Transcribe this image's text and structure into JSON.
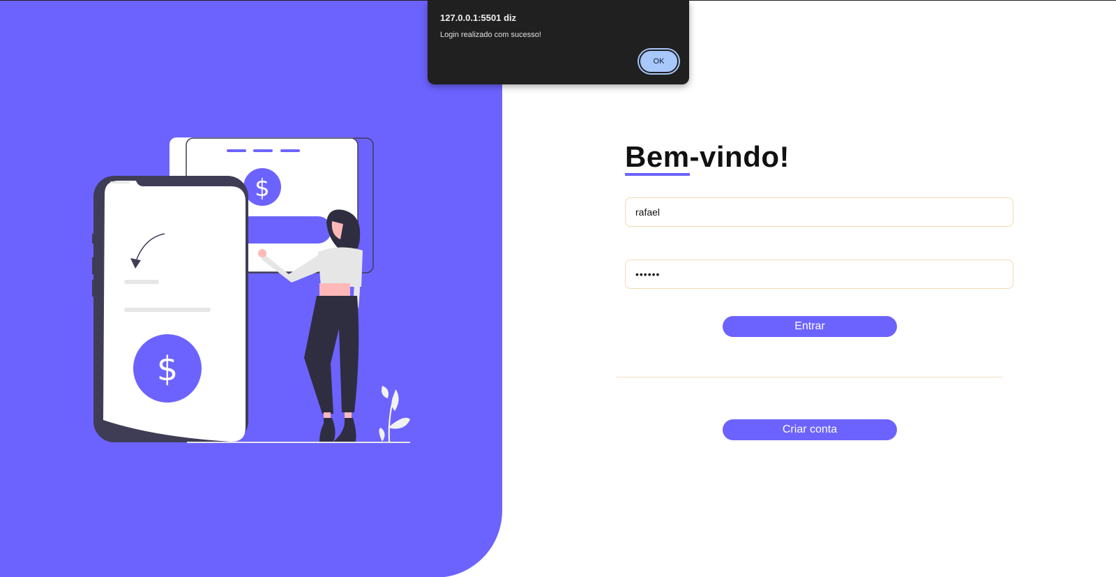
{
  "colors": {
    "accent": "#6c63ff",
    "phone_dark": "#3f3d56",
    "input_border": "#f3d9b3",
    "dialog_bg": "#202020",
    "dialog_button": "#a8c7fa"
  },
  "alert": {
    "origin": "127.0.0.1:5501 diz",
    "message": "Login realizado com sucesso!",
    "ok_label": "OK"
  },
  "illustration": {
    "icons": [
      "dollar-icon",
      "curved-arrow-icon",
      "plant-icon",
      "woman-figure"
    ]
  },
  "form": {
    "title_underlined": "Bem",
    "title_rest": "-vindo!",
    "username_value": "rafael",
    "password_value": "••••••",
    "login_button": "Entrar",
    "create_account_button": "Criar conta"
  }
}
